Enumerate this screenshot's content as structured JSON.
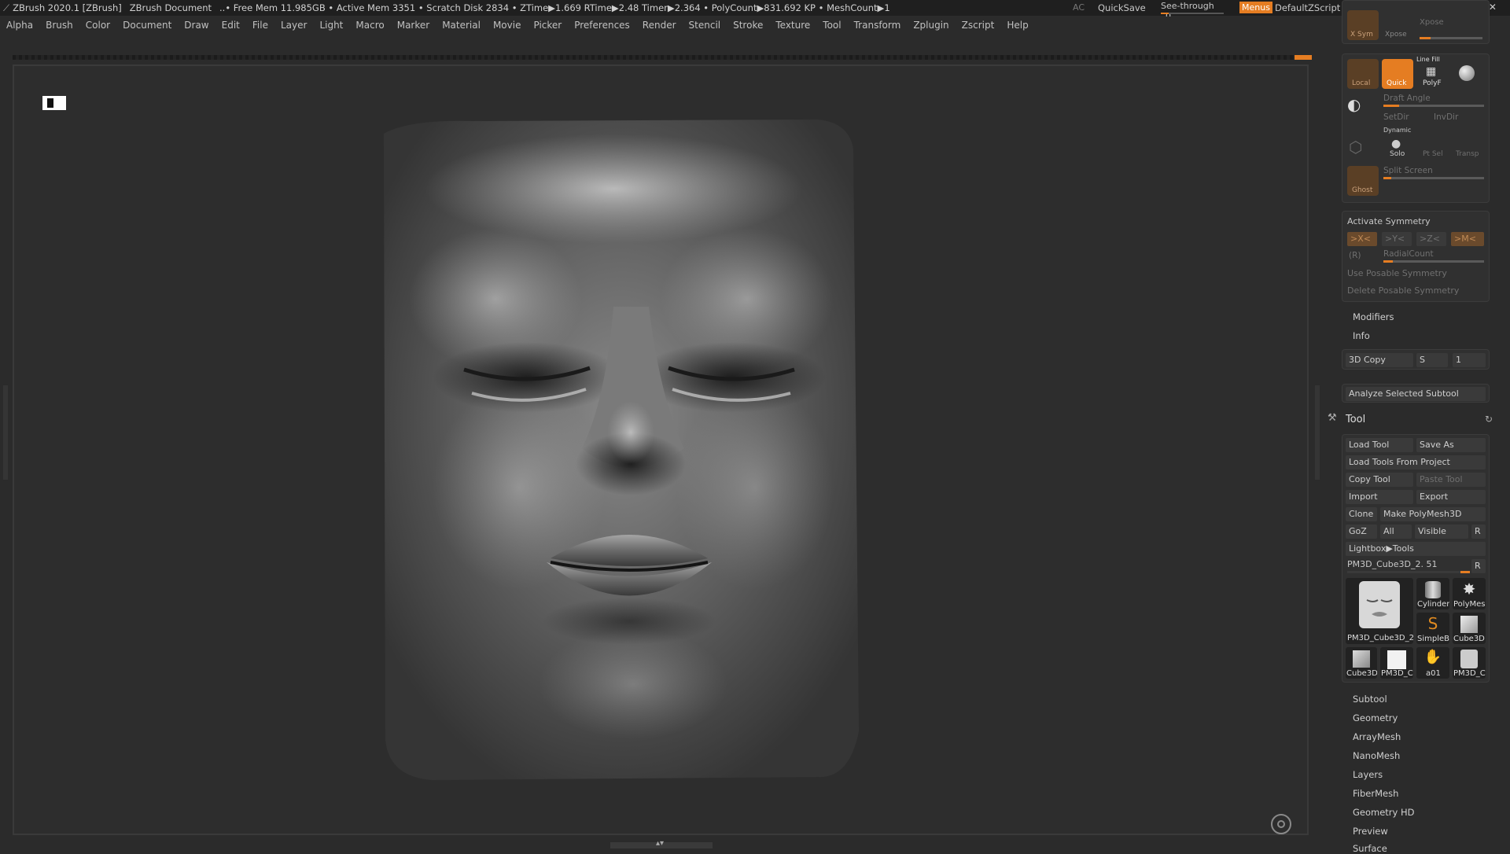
{
  "titlebar": {
    "app": "ZBrush 2020.1 [ZBrush]",
    "document": "ZBrush Document",
    "stats": "..• Free Mem 11.985GB • Active Mem 3351 • Scratch Disk 2834 • ZTime▶1.669 RTime▶2.48 Timer▶2.364 • PolyCount▶831.692 KP • MeshCount▶1",
    "ac": "AC",
    "quicksave": "QuickSave",
    "see_through": "See-through",
    "see_through_value": "0",
    "menus": "Menus",
    "default_zscript": "DefaultZScript"
  },
  "menubar": [
    "Alpha",
    "Brush",
    "Color",
    "Document",
    "Draw",
    "Edit",
    "File",
    "Layer",
    "Light",
    "Macro",
    "Marker",
    "Material",
    "Movie",
    "Picker",
    "Preferences",
    "Render",
    "Stencil",
    "Stroke",
    "Texture",
    "Tool",
    "Transform",
    "Zplugin",
    "Zscript",
    "Help"
  ],
  "top_group": {
    "xsym": "X Sym",
    "xpose": "Xpose",
    "xpose2": "Xpose"
  },
  "display_group": {
    "local": "Local",
    "quick": "Quick",
    "line_fill": "Line Fill",
    "polyf": "PolyF",
    "draft_angle": "Draft Angle",
    "setdir": "SetDir",
    "invdir": "InvDir",
    "dynamic": "Dynamic",
    "solo": "Solo",
    "ptsel": "Pt Sel",
    "transp": "Transp",
    "split_screen": "Split Screen",
    "ghost": "Ghost"
  },
  "symmetry": {
    "activate": "Activate Symmetry",
    "x": ">X<",
    "y": ">Y<",
    "z": ">Z<",
    "m": ">M<",
    "r": "(R)",
    "radial": "RadialCount",
    "use_posable": "Use Posable Symmetry",
    "delete_posable": "Delete Posable Symmetry"
  },
  "modifiers": "Modifiers",
  "info": "Info",
  "copy3d": {
    "label": "3D Copy",
    "s": "S",
    "value": "1"
  },
  "analyze": "Analyze Selected Subtool",
  "tool": {
    "title": "Tool",
    "load_tool": "Load Tool",
    "save_as": "Save As",
    "load_from_project": "Load Tools From Project",
    "copy_tool": "Copy Tool",
    "paste_tool": "Paste Tool",
    "import": "Import",
    "export": "Export",
    "clone": "Clone",
    "make_polymesh": "Make PolyMesh3D",
    "goz": "GoZ",
    "all": "All",
    "visible": "Visible",
    "r": "R",
    "lightbox": "Lightbox▶Tools",
    "current_tool": "PM3D_Cube3D_2. 51",
    "thumbs": [
      {
        "label": "PM3D_Cube3D_2"
      },
      {
        "label": "Cylinder"
      },
      {
        "label": "PolyMes"
      },
      {
        "label": "SimpleB"
      },
      {
        "label": "Cube3D"
      },
      {
        "label": "Cube3D"
      },
      {
        "label": "PM3D_C"
      },
      {
        "label": "a01"
      },
      {
        "label": "PM3D_C"
      }
    ]
  },
  "subpalettes": [
    "Subtool",
    "Geometry",
    "ArrayMesh",
    "NanoMesh",
    "Layers",
    "FiberMesh",
    "Geometry HD",
    "Preview",
    "Surface"
  ],
  "colors": {
    "accent": "#e57d22",
    "bg": "#2b2b2b",
    "panel": "#303030"
  }
}
